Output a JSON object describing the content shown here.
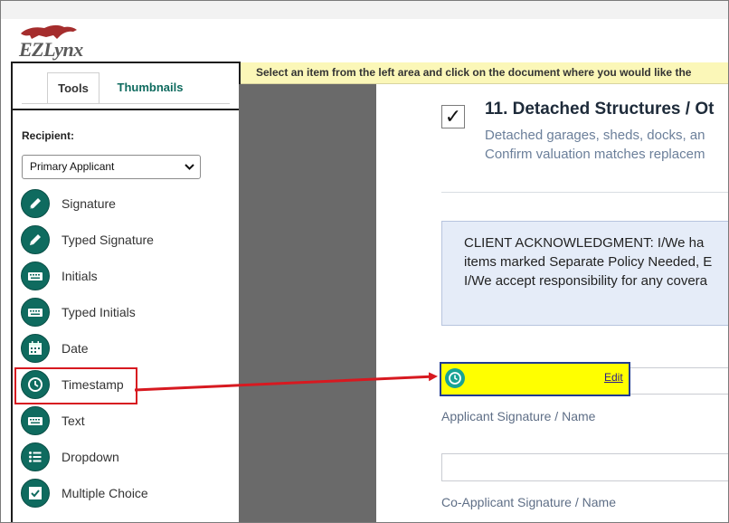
{
  "app": {
    "logo_text": "EZLynx"
  },
  "tabs": [
    {
      "label": "Tools"
    },
    {
      "label": "Thumbnails"
    }
  ],
  "recipient": {
    "label": "Recipient:",
    "selected": "Primary Applicant"
  },
  "tools": [
    {
      "label": "Signature",
      "icon": "pen-icon"
    },
    {
      "label": "Typed Signature",
      "icon": "pen-icon"
    },
    {
      "label": "Initials",
      "icon": "keyboard-icon"
    },
    {
      "label": "Typed Initials",
      "icon": "keyboard-icon"
    },
    {
      "label": "Date",
      "icon": "calendar-icon"
    },
    {
      "label": "Timestamp",
      "icon": "clock-icon"
    },
    {
      "label": "Text",
      "icon": "keyboard-icon"
    },
    {
      "label": "Dropdown",
      "icon": "list-icon"
    },
    {
      "label": "Multiple Choice",
      "icon": "checkbox-icon"
    }
  ],
  "banner": {
    "text": "Select an item from the left area and click on the document where you would like the"
  },
  "document": {
    "checkbox_mark": "✓",
    "section_title": "11. Detached Structures / Ot",
    "section_line1": "Detached garages, sheds, docks, an",
    "section_line2": "Confirm valuation matches replacem",
    "ack_line1": "CLIENT ACKNOWLEDGMENT: I/We ha",
    "ack_line2": "items marked Separate Policy Needed, E",
    "ack_line3": "I/We accept responsibility for any covera",
    "timestamp_edit": "Edit",
    "applicant_label": "Applicant Signature / Name",
    "coapplicant_label": "Co-Applicant Signature / Name"
  },
  "colors": {
    "tool_icon_bg": "#0f6b5f",
    "banner_bg": "#fbf7b8",
    "timestamp_field_bg": "#ffff00",
    "highlight_red": "#d71920"
  }
}
